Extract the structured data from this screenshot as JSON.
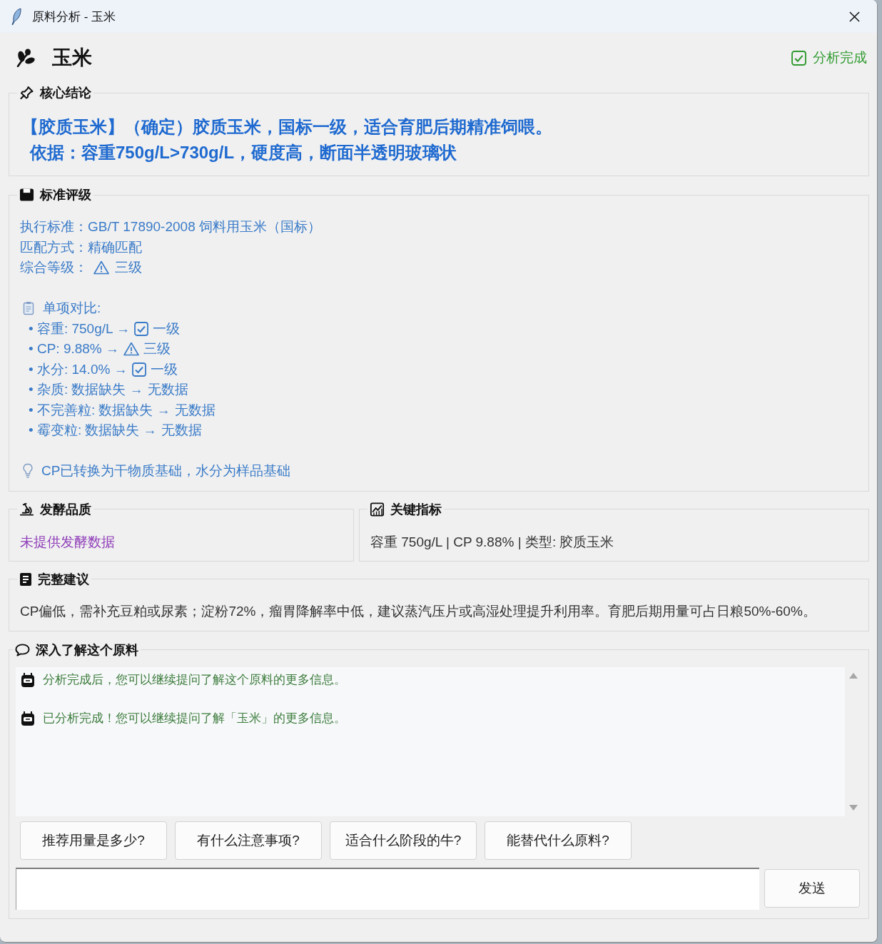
{
  "window": {
    "title": "原料分析 - 玉米"
  },
  "header": {
    "name": "玉米",
    "status": {
      "text": "分析完成",
      "kind": "done"
    }
  },
  "conclusion": {
    "title": "核心结论",
    "lines": [
      "【胶质玉米】（确定）胶质玉米，国标一级，适合育肥后期精准饲喂。",
      "依据：容重750g/L>730g/L，硬度高，断面半透明玻璃状"
    ]
  },
  "grading": {
    "title": "标准评级",
    "fields": [
      {
        "text": "执行标准：GB/T 17890-2008 饲料用玉米（国标）",
        "kind": "plain"
      },
      {
        "text": "匹配方式：精确匹配",
        "kind": "plain"
      },
      {
        "text": "综合等级：",
        "kind": "warn",
        "grade": "三级"
      }
    ],
    "comparison_title": "单项对比:",
    "comparison": [
      {
        "text": "• 容重: 750g/L →",
        "kind": "pass",
        "grade": "一级"
      },
      {
        "text": "• CP: 9.88% →",
        "kind": "warn",
        "grade": "三级"
      },
      {
        "text": "• 水分: 14.0% →",
        "kind": "pass",
        "grade": "一级"
      },
      {
        "text": "• 杂质: 数据缺失 →",
        "kind": "plain",
        "grade": "无数据"
      },
      {
        "text": "• 不完善粒: 数据缺失 →",
        "kind": "plain",
        "grade": "无数据"
      },
      {
        "text": "• 霉变粒: 数据缺失 →",
        "kind": "plain",
        "grade": "无数据"
      }
    ],
    "note": "CP已转换为干物质基础，水分为样品基础"
  },
  "fermentation": {
    "title": "发酵品质",
    "text": "未提供发酵数据",
    "available": false
  },
  "metrics": {
    "title": "关键指标",
    "text": "容重 750g/L | CP 9.88% | 类型: 胶质玉米"
  },
  "advice": {
    "title": "完整建议",
    "text": "CP偏低，需补充豆粕或尿素；淀粉72%，瘤胃降解率中低，建议蒸汽压片或高湿处理提升利用率。育肥后期用量可占日粮50%-60%。"
  },
  "chat": {
    "title": "深入了解这个原料",
    "messages": [
      {
        "kind": "bot",
        "text": "分析完成后，您可以继续提问了解这个原料的更多信息。"
      },
      {
        "kind": "bot",
        "text": "已分析完成！您可以继续提问了解「玉米」的更多信息。"
      }
    ],
    "quick_questions": [
      "推荐用量是多少?",
      "有什么注意事项?",
      "适合什么阶段的牛?",
      "能替代什么原料?"
    ],
    "send_label": "发送"
  }
}
